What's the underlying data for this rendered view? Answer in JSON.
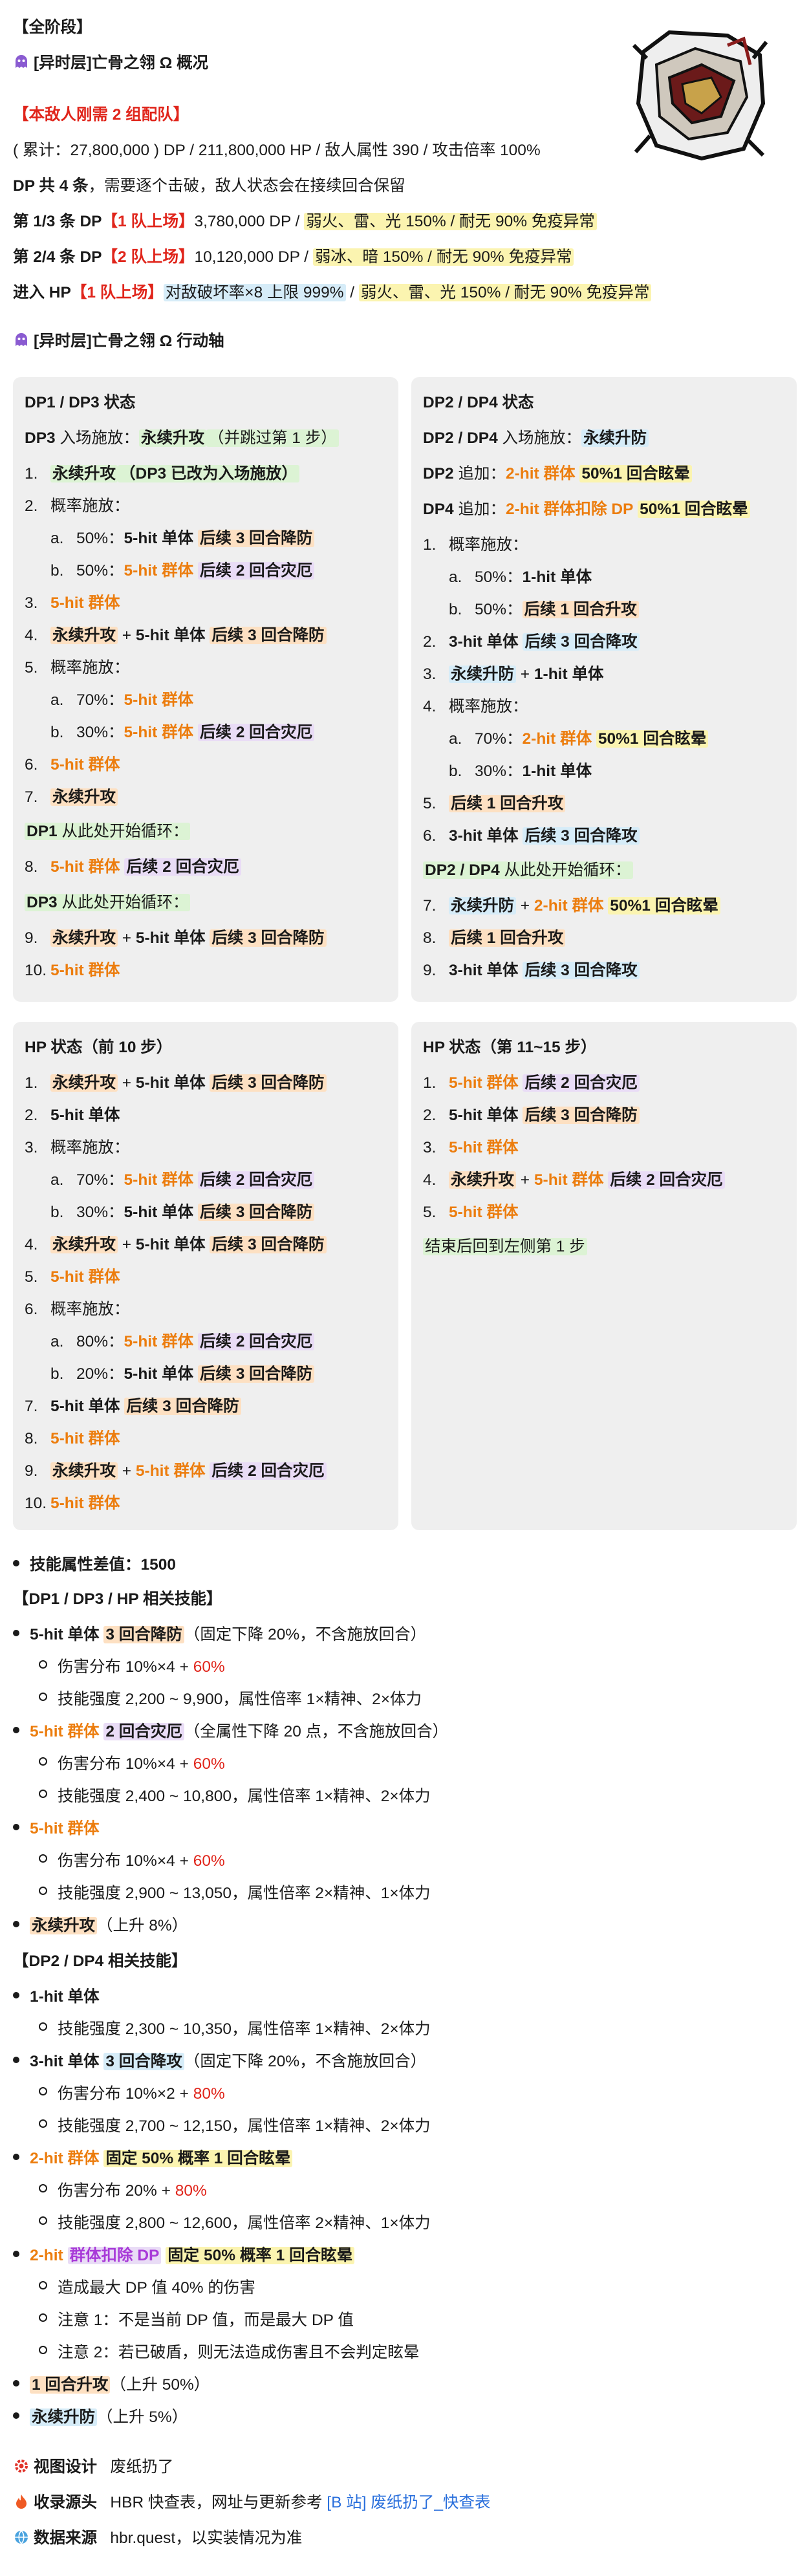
{
  "phase_header": "【全阶段】",
  "title": "[异时层]亡骨之翎 Ω 概况",
  "notice": "【本敌人刚需 2 组配队】",
  "stats": "( 累计：27,800,000 ) DP / 211,800,000 HP / 敌人属性 390 / 攻击倍率 100%",
  "dp_count": "DP 共 4 条",
  "dp_count_rest": "，需要逐个击破，敌人状态会在接续回合保留",
  "dp13_label": "第 1/3 条 DP",
  "dp13_team": "【1 队上场】",
  "dp13_hp": "3,780,000 DP / ",
  "dp13_weak": "弱火、雷、光 150% / 耐无 90% 免疫异常",
  "dp24_label": "第 2/4 条 DP",
  "dp24_team": "【2 队上场】",
  "dp24_hp": "10,120,000 DP / ",
  "dp24_weak": "弱冰、暗 150% / 耐无 90% 免疫异常",
  "hp_label": "进入 HP",
  "hp_team": "【1 队上场】",
  "hp_break": "对敌破坏率×8 上限 999%",
  "hp_sep": " / ",
  "hp_weak": "弱火、雷、光 150% / 耐无 90% 免疫异常",
  "axis_title": "[异时层]亡骨之翎 Ω 行动轴",
  "b1": {
    "title": "DP1 / DP3 状态",
    "r1a": "DP3",
    "r1b": " 入场施放：",
    "r1c": "永续升攻",
    "r1d": "（并跳过第 1 步）",
    "s1n": "1.",
    "s1a": "永续升攻",
    "s1b": "（DP3 已改为入场施放）",
    "s2n": "2.",
    "s2a": "概率施放：",
    "s2an": "a.",
    "s2a1": "50%：",
    "s2a2": "5-hit 单体",
    "s2a3": "后续 3 回合降防",
    "s2bn": "b.",
    "s2b1": "50%：",
    "s2b2": "5-hit 群体",
    "s2b3": "后续 2 回合灾厄",
    "s3n": "3.",
    "s3a": "5-hit 群体",
    "s4n": "4.",
    "s4a": "永续升攻",
    "s4b": " + ",
    "s4c": "5-hit 单体",
    "s4d": "后续 3 回合降防",
    "s5n": "5.",
    "s5a": "概率施放：",
    "s5an": "a.",
    "s5a1": "70%：",
    "s5a2": "5-hit 群体",
    "s5bn": "b.",
    "s5b1": "30%：",
    "s5b2": "5-hit 群体",
    "s5b3": "后续 2 回合灾厄",
    "s6n": "6.",
    "s6a": "5-hit 群体",
    "s7n": "7.",
    "s7a": "永续升攻",
    "loop1a": "DP1",
    "loop1b": " 从此处开始循环：",
    "s8n": "8.",
    "s8a": "5-hit 群体",
    "s8b": "后续 2 回合灾厄",
    "loop3a": "DP3",
    "loop3b": " 从此处开始循环：",
    "s9n": "9.",
    "s9a": "永续升攻",
    "s9b": " + ",
    "s9c": "5-hit 单体",
    "s9d": "后续 3 回合降防",
    "s10n": "10.",
    "s10a": "5-hit 群体"
  },
  "b2": {
    "title": "DP2 / DP4 状态",
    "r1a": "DP2 / DP4",
    "r1b": " 入场施放：",
    "r1c": "永续升防",
    "r2a": "DP2",
    "r2b": " 追加：",
    "r2c": "2-hit 群体",
    "r2d": "50%1 回合眩晕",
    "r3a": "DP4",
    "r3b": " 追加：",
    "r3c": "2-hit 群体扣除 DP",
    "r3d": "50%1 回合眩晕",
    "s1n": "1.",
    "s1a": "概率施放：",
    "s1an": "a.",
    "s1a1": "50%：",
    "s1a2": "1-hit 单体",
    "s1bn": "b.",
    "s1b1": "50%：",
    "s1b2": "后续 1 回合升攻",
    "s2n": "2.",
    "s2a": "3-hit 单体",
    "s2b": "后续 3 回合降攻",
    "s3n": "3.",
    "s3a": "永续升防",
    "s3b": " + ",
    "s3c": "1-hit 单体",
    "s4n": "4.",
    "s4a": "概率施放：",
    "s4an": "a.",
    "s4a1": "70%：",
    "s4a2": "2-hit 群体",
    "s4a3": "50%1 回合眩晕",
    "s4bn": "b.",
    "s4b1": "30%：",
    "s4b2": "1-hit 单体",
    "s5n": "5.",
    "s5a": "后续 1 回合升攻",
    "s6n": "6.",
    "s6a": "3-hit 单体",
    "s6b": "后续 3 回合降攻",
    "loopa": "DP2 / DP4",
    "loopb": " 从此处开始循环：",
    "s7n": "7.",
    "s7a": "永续升防",
    "s7b": " + ",
    "s7c": "2-hit 群体",
    "s7d": "50%1 回合眩晕",
    "s8n": "8.",
    "s8a": "后续 1 回合升攻",
    "s9n": "9.",
    "s9a": "3-hit 单体",
    "s9b": "后续 3 回合降攻"
  },
  "b3": {
    "title": "HP 状态（前 10 步）",
    "s1n": "1.",
    "s1a": "永续升攻",
    "s1b": " + ",
    "s1c": "5-hit 单体",
    "s1d": "后续 3 回合降防",
    "s2n": "2.",
    "s2a": "5-hit 单体",
    "s3n": "3.",
    "s3a": "概率施放：",
    "s3an": "a.",
    "s3a1": "70%：",
    "s3a2": "5-hit 群体",
    "s3a3": "后续 2 回合灾厄",
    "s3bn": "b.",
    "s3b1": "30%：",
    "s3b2": "5-hit 单体",
    "s3b3": "后续 3 回合降防",
    "s4n": "4.",
    "s4a": "永续升攻",
    "s4b": " + ",
    "s4c": "5-hit 单体",
    "s4d": "后续 3 回合降防",
    "s5n": "5.",
    "s5a": "5-hit 群体",
    "s6n": "6.",
    "s6a": "概率施放：",
    "s6an": "a.",
    "s6a1": "80%：",
    "s6a2": "5-hit 群体",
    "s6a3": "后续 2 回合灾厄",
    "s6bn": "b.",
    "s6b1": "20%：",
    "s6b2": "5-hit 单体",
    "s6b3": "后续 3 回合降防",
    "s7n": "7.",
    "s7a": "5-hit 单体",
    "s7b": "后续 3 回合降防",
    "s8n": "8.",
    "s8a": "5-hit 群体",
    "s9n": "9.",
    "s9a": "永续升攻",
    "s9b": " + ",
    "s9c": "5-hit 群体",
    "s9d": "后续 2 回合灾厄",
    "s10n": "10.",
    "s10a": "5-hit 群体"
  },
  "b4": {
    "title": "HP 状态（第 11~15 步）",
    "s1n": "1.",
    "s1a": "5-hit 群体",
    "s1b": "后续 2 回合灾厄",
    "s2n": "2.",
    "s2a": "5-hit 单体",
    "s2b": "后续 3 回合降防",
    "s3n": "3.",
    "s3a": "5-hit 群体",
    "s4n": "4.",
    "s4a": "永续升攻",
    "s4b": " + ",
    "s4c": "5-hit 群体",
    "s4d": "后续 2 回合灾厄",
    "s5n": "5.",
    "s5a": "5-hit 群体",
    "end": "结束后回到左侧第 1 步"
  },
  "skills": {
    "diff": "技能属性差值：1500",
    "h1": "【DP1 / DP3 / HP 相关技能】",
    "k1a": "5-hit 单体",
    "k1b": "3 回合降防",
    "k1c": "（固定下降 20%，不含施放回合）",
    "k1s1a": "伤害分布 10%×4 + ",
    "k1s1b": "60%",
    "k1s2": "技能强度 2,200 ~ 9,900，属性倍率 1×精神、2×体力",
    "k2a": "5-hit 群体",
    "k2b": "2 回合灾厄",
    "k2c": "（全属性下降 20 点，不含施放回合）",
    "k2s1a": "伤害分布 10%×4 + ",
    "k2s1b": "60%",
    "k2s2": "技能强度 2,400 ~ 10,800，属性倍率 1×精神、2×体力",
    "k3a": "5-hit 群体",
    "k3s1a": "伤害分布 10%×4 + ",
    "k3s1b": "60%",
    "k3s2": "技能强度 2,900 ~ 13,050，属性倍率 2×精神、1×体力",
    "k4a": "永续升攻",
    "k4b": "（上升 8%）",
    "h2": "【DP2 / DP4 相关技能】",
    "k5a": "1-hit 单体",
    "k5s1": "技能强度 2,300 ~ 10,350，属性倍率 1×精神、2×体力",
    "k6a": "3-hit 单体",
    "k6b": "3 回合降攻",
    "k6c": "（固定下降 20%，不含施放回合）",
    "k6s1a": "伤害分布 10%×2 + ",
    "k6s1b": "80%",
    "k6s2": "技能强度 2,700 ~ 12,150，属性倍率 1×精神、2×体力",
    "k7a": "2-hit 群体",
    "k7b": "固定 50% 概率 1 回合眩晕",
    "k7s1a": "伤害分布 20% + ",
    "k7s1b": "80%",
    "k7s2": "技能强度 2,800 ~ 12,600，属性倍率 2×精神、1×体力",
    "k8a": "2-hit ",
    "k8b": "群体扣除 DP",
    "k8c": "固定 50% 概率 1 回合眩晕",
    "k8s1": "造成最大 DP 值 40% 的伤害",
    "k8s2": "注意 1：不是当前 DP 值，而是最大 DP 值",
    "k8s3": "注意 2：若已破盾，则无法造成伤害且不会判定眩晕",
    "k9a": "1 回合升攻",
    "k9b": "（上升 50%）",
    "k10a": "永续升防",
    "k10b": "（上升 5%）"
  },
  "footer": {
    "design_label": "视图设计",
    "design_val": "废纸扔了",
    "source_label": "收录源头",
    "source_val": "HBR 快查表，网址与更新参考 ",
    "source_link": "[B 站] 废纸扔了_快查表",
    "data_label": "数据来源",
    "data_val": "hbr.quest，以实装情况为准"
  },
  "icons": {
    "title_icon": "purple-ghost-icon",
    "design_icon": "gear-icon",
    "source_icon": "fire-icon",
    "data_icon": "globe-icon",
    "boss": "boss-portrait-icon"
  }
}
